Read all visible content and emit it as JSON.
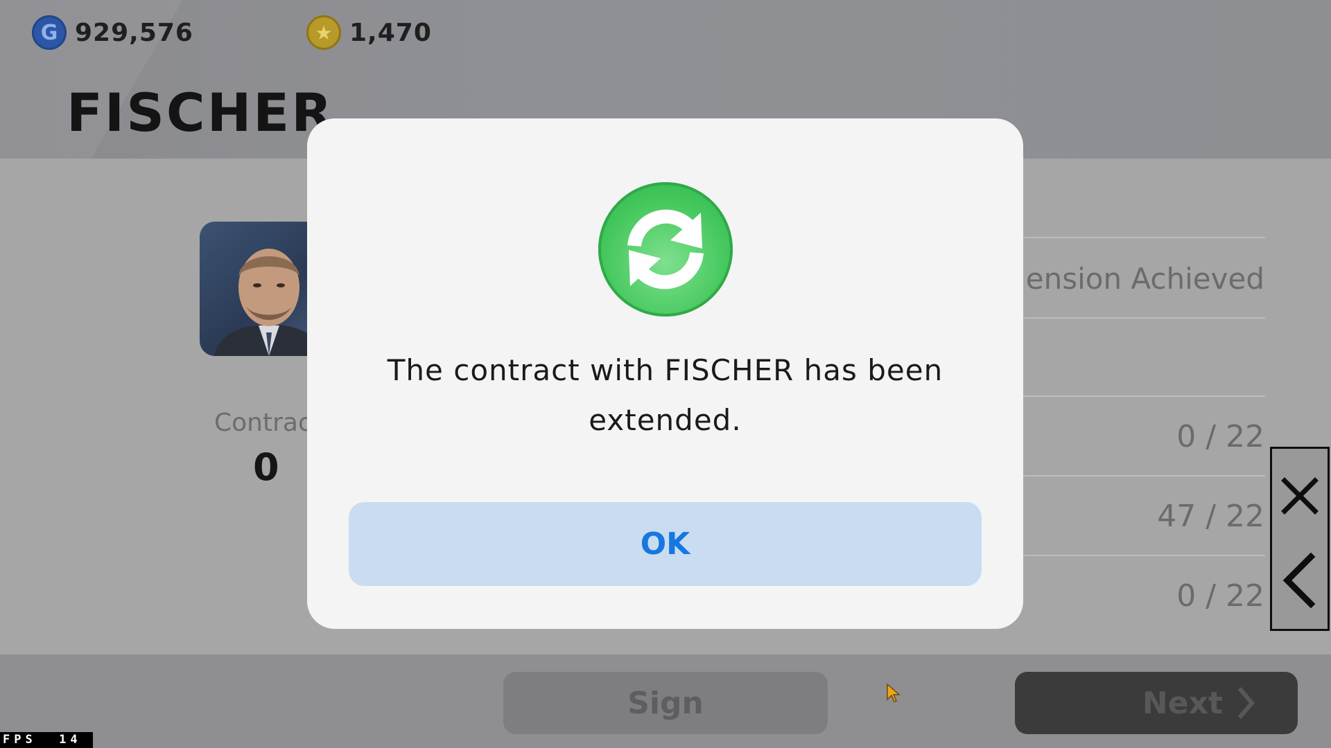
{
  "header": {
    "gp": {
      "icon": "gp-coin-icon",
      "value": "929,576"
    },
    "coins": {
      "icon": "star-coin-icon",
      "value": "1,470"
    },
    "player_name": "FISCHER"
  },
  "player_panel": {
    "contract_label": "Contrac",
    "contract_value": "0"
  },
  "right_panel": {
    "extension_text": "ension Achieved",
    "stats": [
      "0 / 22",
      "47 / 22",
      "0 / 22"
    ]
  },
  "side_controls": {
    "close_icon": "close-icon",
    "back_icon": "chevron-left-icon"
  },
  "bottom_bar": {
    "sign_label": "Sign",
    "next_label": "Next"
  },
  "dialog": {
    "icon": "refresh-icon",
    "message": "The contract with FISCHER has been extended.",
    "ok_label": "OK"
  },
  "fps_counter": "FPS  14",
  "colors": {
    "accent_blue": "#1677e0",
    "ok_bg": "#c9dcf1",
    "success_green": "#44c75c"
  }
}
